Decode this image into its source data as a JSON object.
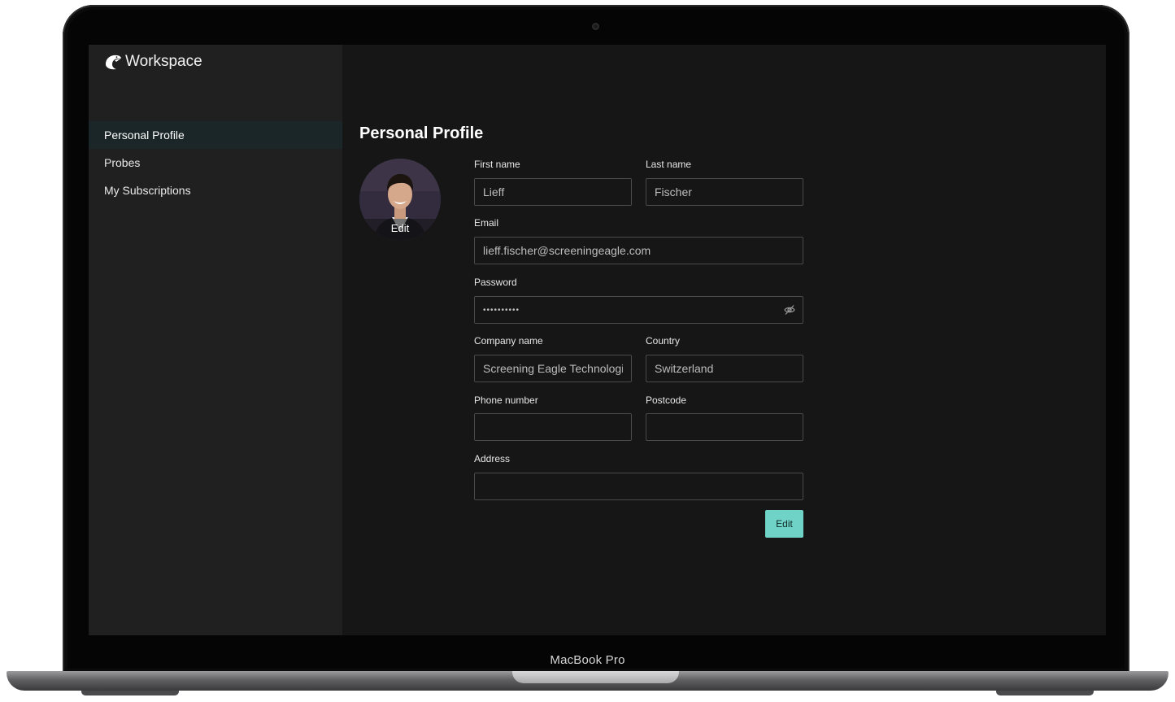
{
  "device": {
    "model_label": "MacBook Pro"
  },
  "app": {
    "name": "Workspace"
  },
  "sidebar": {
    "items": [
      {
        "label": "Personal Profile",
        "active": true
      },
      {
        "label": "Probes",
        "active": false
      },
      {
        "label": "My Subscriptions",
        "active": false
      }
    ]
  },
  "profile": {
    "title": "Personal Profile",
    "avatar_edit_label": "Edit",
    "fields": {
      "first_name": {
        "label": "First name",
        "value": "Lieff"
      },
      "last_name": {
        "label": "Last name",
        "value": "Fischer"
      },
      "email": {
        "label": "Email",
        "value": "lieff.fischer@screeningeagle.com"
      },
      "password": {
        "label": "Password",
        "value": "••••••••••"
      },
      "company": {
        "label": "Company name",
        "value": "Screening Eagle Technologies"
      },
      "country": {
        "label": "Country",
        "value": "Switzerland"
      },
      "phone": {
        "label": "Phone number",
        "value": ""
      },
      "postcode": {
        "label": "Postcode",
        "value": ""
      },
      "address": {
        "label": "Address",
        "value": ""
      }
    },
    "edit_button_label": "Edit"
  },
  "colors": {
    "accent": "#6fd3c7",
    "sidebar_bg": "#202020",
    "content_bg": "#161616",
    "active_nav_bg": "#1a2628"
  },
  "icons": {
    "brand": "eagle-icon",
    "password_toggle": "eye-slash-icon"
  }
}
